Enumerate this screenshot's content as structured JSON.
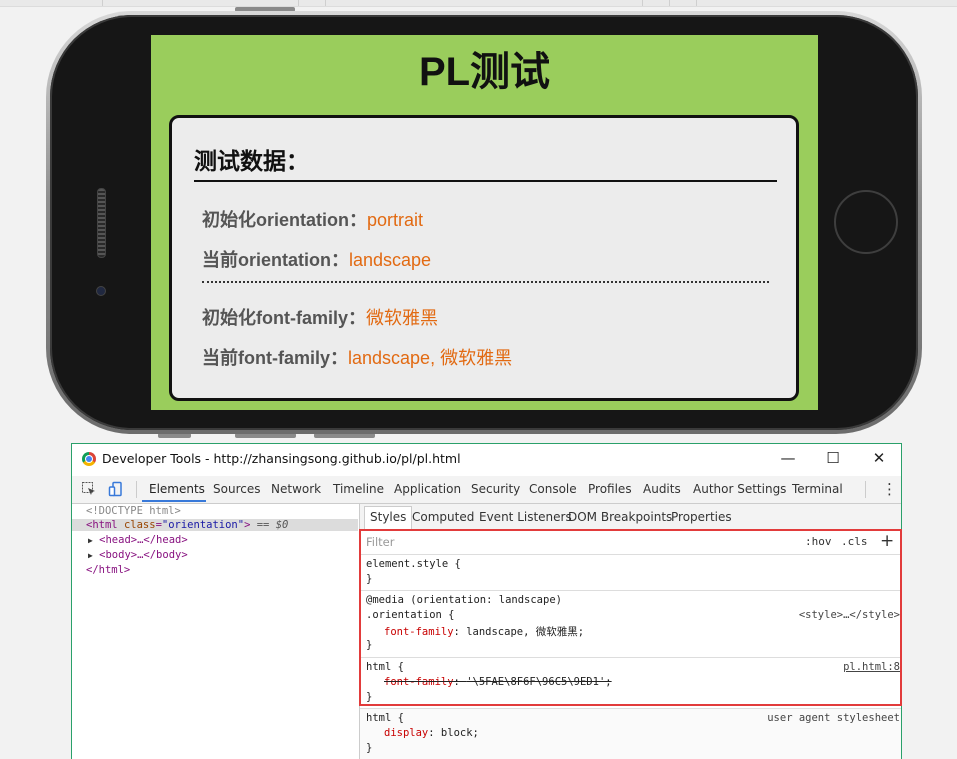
{
  "phone": {
    "page_title": "PL测试",
    "card_title": "测试数据：",
    "rows": [
      {
        "label": "初始化orientation：",
        "value": "portrait"
      },
      {
        "label": "当前orientation：",
        "value": "landscape"
      },
      {
        "label": "初始化font-family：",
        "value": "微软雅黑"
      },
      {
        "label": "当前font-family：",
        "value": "landscape, 微软雅黑"
      }
    ]
  },
  "devtools": {
    "window_title": "Developer Tools - http://zhansingsong.github.io/pl/pl.html",
    "window_controls": [
      "—",
      "☐",
      "✕"
    ],
    "tabs": [
      "Elements",
      "Sources",
      "Network",
      "Timeline",
      "Application",
      "Security",
      "Console",
      "Profiles",
      "Audits",
      "Author Settings",
      "Terminal"
    ],
    "active_tab": "Elements",
    "dom": {
      "doctype": "<!DOCTYPE html>",
      "html_open_tag": "html",
      "html_attr": "class",
      "html_attr_value": "\"orientation\"",
      "selected_marker": "== $0",
      "head": "<head>…</head>",
      "body": "<body>…</body>",
      "html_close": "</html>"
    },
    "styles_tabs": [
      "Styles",
      "Computed",
      "Event Listeners",
      "DOM Breakpoints",
      "Properties"
    ],
    "filter_placeholder": "Filter",
    "hov": ":hov",
    "cls": ".cls",
    "plus": "+",
    "rules": {
      "element_style": "element.style {",
      "close_brace": "}",
      "media": "@media (orientation: landscape)",
      "orientation_selector": ".orientation {",
      "orientation_source": "<style>…</style>",
      "orientation_prop": "font-family",
      "orientation_value": "landscape, 微软雅黑;",
      "html_selector": "html {",
      "html_source": "pl.html:8",
      "html_prop": "font-family",
      "html_value": "'\\5FAE\\8F6F\\96C5\\9ED1';",
      "ua_selector": "html {",
      "ua_source": "user agent stylesheet",
      "ua_prop": "display",
      "ua_value": "block;"
    }
  }
}
